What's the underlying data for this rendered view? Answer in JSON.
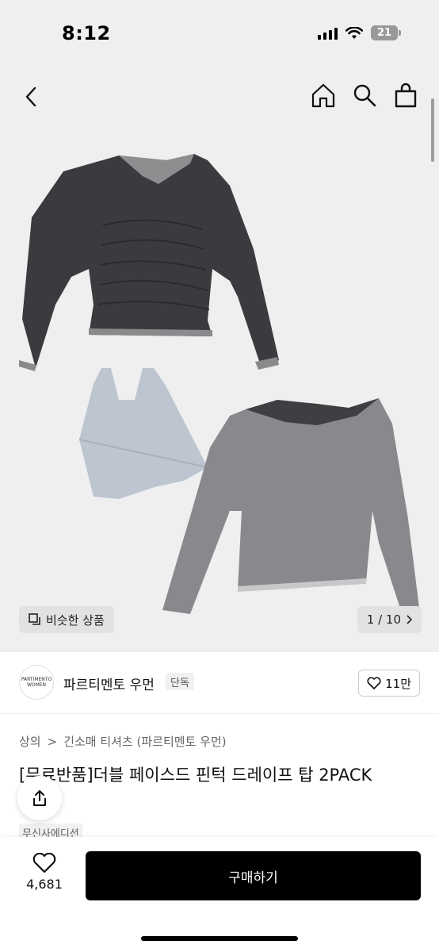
{
  "status_bar": {
    "time": "8:12",
    "battery": "21"
  },
  "header": {
    "icons": [
      "back-arrow-icon",
      "home-icon",
      "search-icon",
      "shopping-bag-icon"
    ]
  },
  "gallery": {
    "similar_label": "비슷한 상품",
    "counter": "1 / 10"
  },
  "brand": {
    "logo_text_line1": "PARTIMENTO",
    "logo_text_line2": "WOMEN",
    "name": "파르티멘토 우먼",
    "tag": "단독",
    "likes": "11만"
  },
  "breadcrumb": {
    "category": "상의",
    "separator": ">",
    "subcategory": "긴소매 티셔츠 (파르티멘토 우먼)"
  },
  "product": {
    "title": "[무료반품]더블 페이스드 핀턱 드레이프 탑 2PACK",
    "title_continued": "-",
    "edition": "무신사에디션"
  },
  "bottom_bar": {
    "wish_count": "4,681",
    "buy_label": "구매하기"
  },
  "colors": {
    "accent": "#000000",
    "background": "#efefef"
  }
}
